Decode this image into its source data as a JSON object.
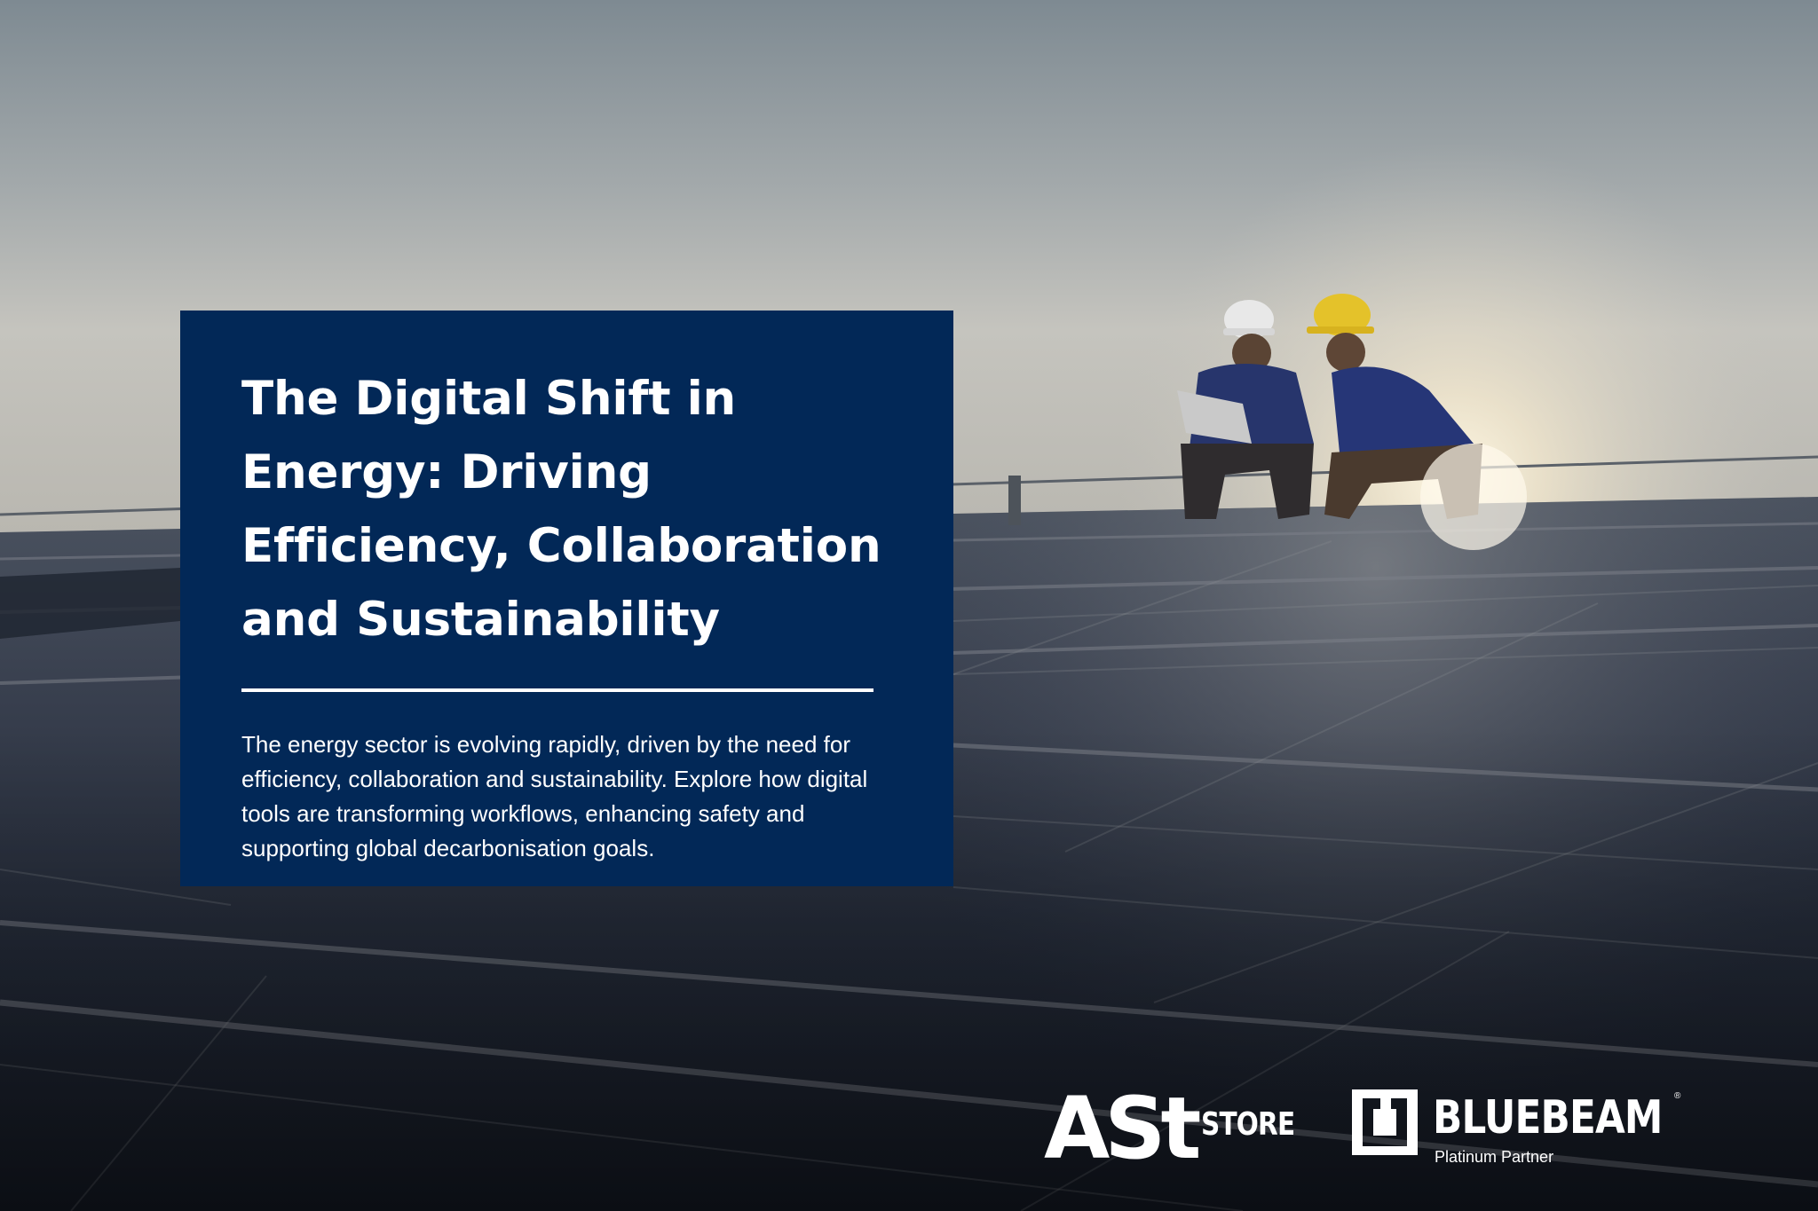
{
  "card": {
    "title": "The Digital Shift in Energy: Driving Efficiency, Collaboration and Sustainability",
    "body": "The energy sector is evolving rapidly, driven by the need for efficiency, collaboration and sustainability. Explore how digital tools are transforming workflows, enhancing safety and supporting global decarbonisation goals.",
    "background_color": "#022857",
    "text_color": "#ffffff"
  },
  "logos": {
    "ast": {
      "main": "ASt",
      "sub": "STORE"
    },
    "bluebeam": {
      "name": "BLUEBEAM",
      "registered": "®",
      "tier": "Platinum Partner"
    }
  },
  "background": {
    "description_icon": "solar-panel-roof-workers-photo",
    "sky_color": "#8f989c",
    "panel_color": "#1b2331"
  }
}
